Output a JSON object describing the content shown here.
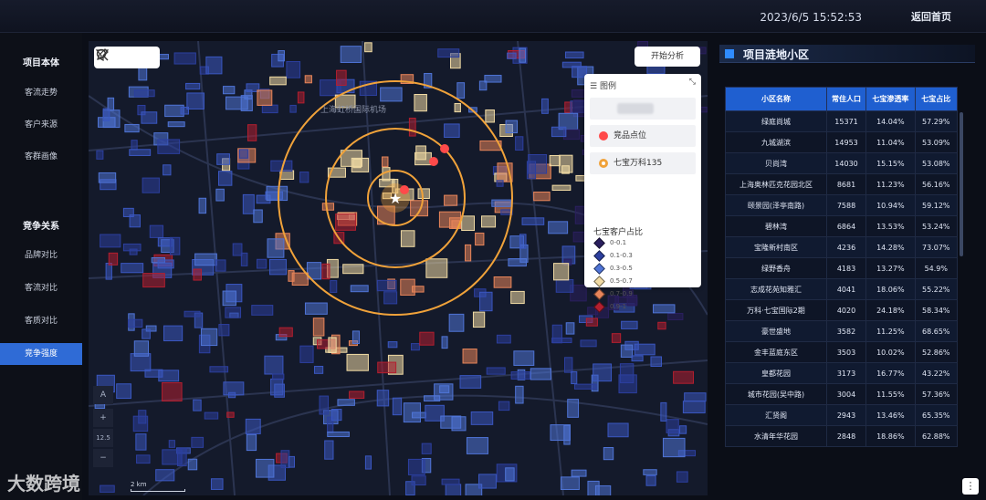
{
  "header": {
    "datetime": "2023/6/5 15:52:53",
    "home_label": "返回首页"
  },
  "sidebar": {
    "group1": "项目本体",
    "items1": [
      "客流走势",
      "客户来源",
      "客群画像"
    ],
    "group2": "竞争关系",
    "items2": [
      "品牌对比",
      "客流对比",
      "客质对比",
      "竞争强度"
    ],
    "active": "竞争强度"
  },
  "map": {
    "analyze_button": "开始分析",
    "airport_label": "上海虹桥国际机场",
    "scale_label": "2 km",
    "zoom_level": "12.5",
    "compass_label": "A",
    "zoom_in": "+",
    "zoom_out": "−",
    "legend": {
      "title": "图例",
      "competitor_label": "竞品点位",
      "project_label": "七宝万科135",
      "ratio_title": "七宝客户占比",
      "levels": [
        {
          "label": "0-0.1",
          "color": "#2a1f5e"
        },
        {
          "label": "0.1-0.3",
          "color": "#2c3f9e"
        },
        {
          "label": "0.3-0.5",
          "color": "#4f74d6"
        },
        {
          "label": "0.5-0.7",
          "color": "#f1dba4"
        },
        {
          "label": "0.7-0.9",
          "color": "#e8855a"
        },
        {
          "label": "0.9-1",
          "color": "#b31f2f"
        }
      ]
    }
  },
  "panel": {
    "title": "项目涟地小区",
    "columns": [
      "小区名称",
      "常住人口",
      "七宝渗透率",
      "七宝占比"
    ],
    "rows": [
      [
        "绿庭尚城",
        "15371",
        "14.04%",
        "57.29%"
      ],
      [
        "九城湖滨",
        "14953",
        "11.04%",
        "53.09%"
      ],
      [
        "贝尚湾",
        "14030",
        "15.15%",
        "53.08%"
      ],
      [
        "上海奥林匹克花园北区",
        "8681",
        "11.23%",
        "56.16%"
      ],
      [
        "颐景园(泽亭南路)",
        "7588",
        "10.94%",
        "59.12%"
      ],
      [
        "碧林湾",
        "6864",
        "13.53%",
        "53.24%"
      ],
      [
        "宝隆新村南区",
        "4236",
        "14.28%",
        "73.07%"
      ],
      [
        "绿野香舟",
        "4183",
        "13.27%",
        "54.9%"
      ],
      [
        "志成花苑知雅汇",
        "4041",
        "18.06%",
        "55.22%"
      ],
      [
        "万科·七宝国际2期",
        "4020",
        "24.18%",
        "58.34%"
      ],
      [
        "豪世盛地",
        "3582",
        "11.25%",
        "68.65%"
      ],
      [
        "金丰蓝庭东区",
        "3503",
        "10.02%",
        "52.86%"
      ],
      [
        "皇都花园",
        "3173",
        "16.77%",
        "43.22%"
      ],
      [
        "城市花园(吴中路)",
        "3004",
        "11.55%",
        "57.36%"
      ],
      [
        "汇贤阁",
        "2943",
        "13.46%",
        "65.35%"
      ],
      [
        "水清年华花园",
        "2848",
        "18.86%",
        "62.88%"
      ]
    ]
  },
  "watermark": "大数跨境"
}
